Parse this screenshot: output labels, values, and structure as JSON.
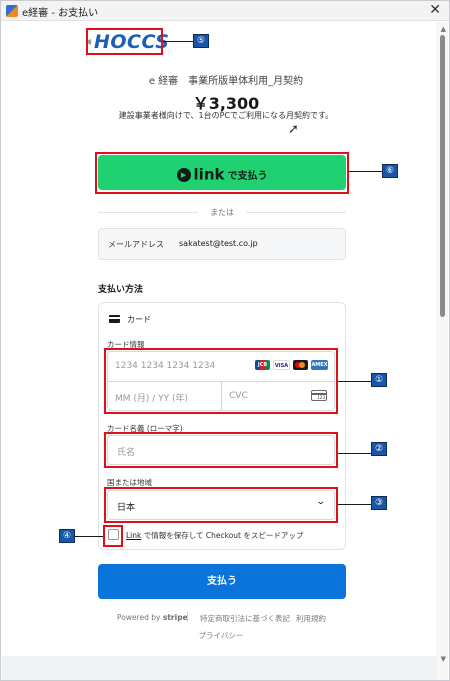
{
  "window": {
    "title": "e経審 - お支払い",
    "close_glyph": "✕"
  },
  "merchant": {
    "logo_text": "HOCCS",
    "back_glyph": "◀"
  },
  "product": {
    "name": "e 経審　事業所版単体利用_月契約",
    "price": "￥3,300",
    "description": "建設事業者様向けで、1台のPCでご利用になる月契約です。"
  },
  "link_button": {
    "play_glyph": "▶",
    "brand": "link",
    "label": "で支払う"
  },
  "divider_text": "または",
  "email": {
    "label": "メールアドレス",
    "value": "sakatest@test.co.jp"
  },
  "payment_method": {
    "title": "支払い方法",
    "card_tab_label": "カード",
    "card_info_label": "カード情報",
    "card_number_placeholder": "1234 1234 1234 1234",
    "expiry_placeholder": "MM (月) / YY (年)",
    "cvc_placeholder": "CVC",
    "cvc_icon_text": "123",
    "card_brands": {
      "jcb": "JCB",
      "visa": "VISA",
      "amex": "AMEX"
    },
    "cardholder_label": "カード名義 (ローマ字)",
    "cardholder_placeholder": "氏名",
    "country_label": "国または地域",
    "country_value": "日本",
    "chevron_glyph": "⌄",
    "save_link_label": "Link",
    "save_text": "で情報を保存して Checkout をスピードアップ"
  },
  "pay_button": {
    "label": "支払う"
  },
  "footer": {
    "powered_prefix": "Powered by",
    "powered_brand": "stripe",
    "law_link": "特定商取引法に基づく表記",
    "terms_link": "利用規約",
    "privacy_link": "プライバシー"
  },
  "callouts": {
    "n1": "①",
    "n2": "②",
    "n3": "③",
    "n4": "④",
    "n5": "⑤",
    "n6": "⑥"
  },
  "colors": {
    "link_green": "#1fd170",
    "pay_blue": "#0a74da",
    "callout_red": "#e0101a",
    "badge_blue": "#1a56a8"
  }
}
